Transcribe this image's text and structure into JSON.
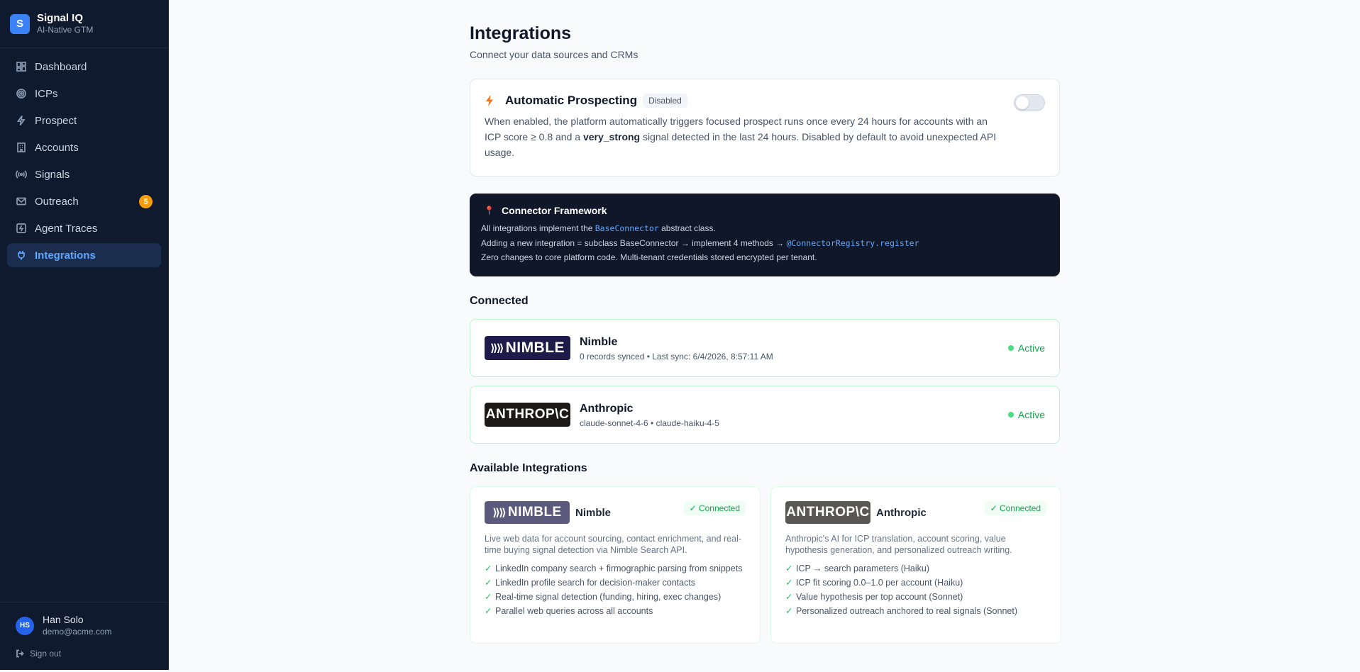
{
  "brand": {
    "letter": "S",
    "name": "Signal IQ",
    "tagline": "AI-Native GTM"
  },
  "nav": [
    {
      "label": "Dashboard",
      "icon": "dashboard-icon",
      "active": false
    },
    {
      "label": "ICPs",
      "icon": "target-icon",
      "active": false
    },
    {
      "label": "Prospect",
      "icon": "bolt-icon",
      "active": false
    },
    {
      "label": "Accounts",
      "icon": "building-icon",
      "active": false
    },
    {
      "label": "Signals",
      "icon": "broadcast-icon",
      "active": false
    },
    {
      "label": "Outreach",
      "icon": "mail-icon",
      "active": false,
      "badge": "5"
    },
    {
      "label": "Agent Traces",
      "icon": "trace-icon",
      "active": false
    },
    {
      "label": "Integrations",
      "icon": "plug-icon",
      "active": true
    }
  ],
  "user": {
    "initials": "HS",
    "name": "Han Solo",
    "email": "demo@acme.com",
    "signout": "Sign out"
  },
  "page": {
    "title": "Integrations",
    "subtitle": "Connect your data sources and CRMs"
  },
  "auto": {
    "title": "Automatic Prospecting",
    "status": "Disabled",
    "enabled": false,
    "desc_1": "When enabled, the platform automatically triggers focused prospect runs once every 24 hours for accounts with an ICP score ≥ 0.8 and a ",
    "desc_bold": "very_strong",
    "desc_2": " signal detected in the last 24 hours. Disabled by default to avoid unexpected API usage."
  },
  "framework": {
    "title": "Connector Framework",
    "line1_a": "All integrations implement the ",
    "line1_code": "BaseConnector",
    "line1_b": " abstract class.",
    "line2_a": "Adding a new integration = subclass BaseConnector → implement 4 methods → ",
    "line2_code": "@ConnectorRegistry.register",
    "line3": "Zero changes to core platform code. Multi-tenant credentials stored encrypted per tenant."
  },
  "connected": {
    "title": "Connected",
    "items": [
      {
        "logo": "NIMBLE",
        "name": "Nimble",
        "meta": "0 records synced • Last sync: 6/4/2026, 8:57:11 AM",
        "status": "Active"
      },
      {
        "logo": "ANTHROP\\C",
        "name": "Anthropic",
        "meta": "claude-sonnet-4-6 • claude-haiku-4-5",
        "status": "Active"
      }
    ]
  },
  "available": {
    "title": "Available Integrations",
    "items": [
      {
        "logo": "NIMBLE",
        "name": "Nimble",
        "badge": "✓ Connected",
        "desc": "Live web data for account sourcing, contact enrichment, and real-time buying signal detection via Nimble Search API.",
        "features": [
          "LinkedIn company search + firmographic parsing from snippets",
          "LinkedIn profile search for decision-maker contacts",
          "Real-time signal detection (funding, hiring, exec changes)",
          "Parallel web queries across all accounts"
        ]
      },
      {
        "logo": "ANTHROP\\C",
        "name": "Anthropic",
        "badge": "✓ Connected",
        "desc": "Anthropic's AI for ICP translation, account scoring, value hypothesis generation, and personalized outreach writing.",
        "features": [
          "ICP → search parameters (Haiku)",
          "ICP fit scoring 0.0–1.0 per account (Haiku)",
          "Value hypothesis per top account (Sonnet)",
          "Personalized outreach anchored to real signals (Sonnet)"
        ]
      }
    ]
  },
  "colors": {
    "sidebar": "#0f1a2e",
    "accent": "#3b82f6",
    "active_green": "#16a34a",
    "badge": "#f59e0b"
  }
}
